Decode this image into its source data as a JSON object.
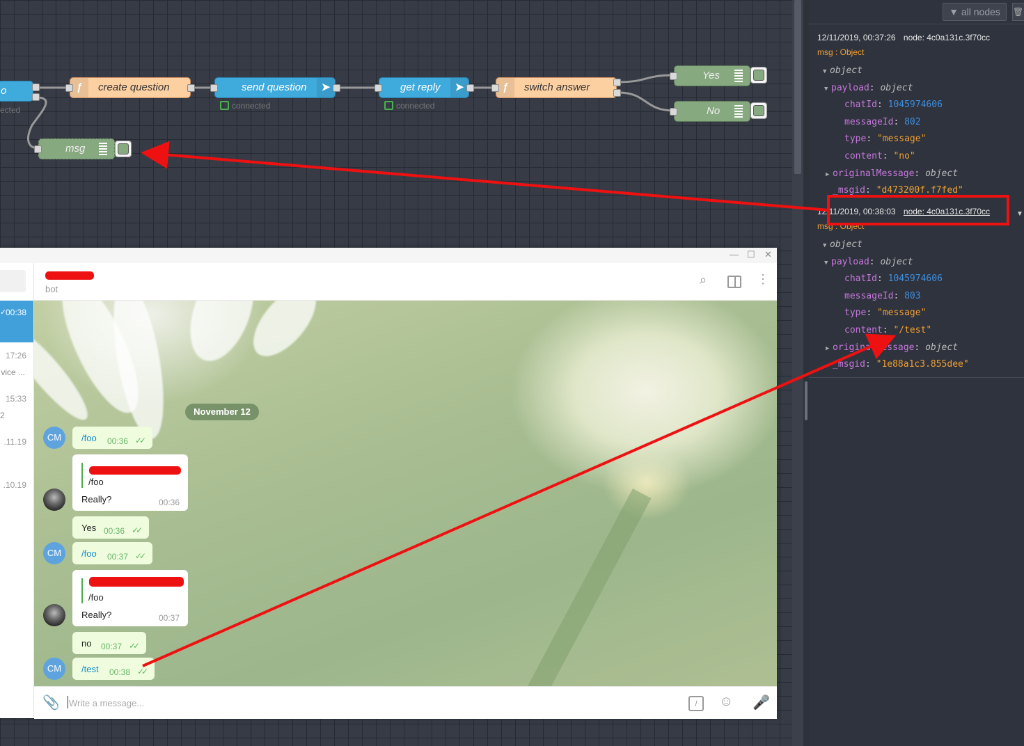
{
  "flow": {
    "nodes": {
      "left_partial": "o",
      "left_partial_status": "ected",
      "create_question": "create question",
      "send_question": "send question",
      "get_reply": "get reply",
      "switch_answer": "switch answer",
      "yes": "Yes",
      "no": "No",
      "msg": "msg"
    },
    "status_connected": "connected"
  },
  "debug": {
    "filter_label": "all nodes",
    "messages": [
      {
        "timestamp": "12/11/2019, 00:37:26",
        "node": "node: 4c0a131c.3f70cc",
        "type": "msg : Object",
        "root": "object",
        "payload_key": "payload",
        "payload_type": "object",
        "fields": [
          {
            "key": "chatId",
            "value": "1045974606"
          },
          {
            "key": "messageId",
            "value": "802"
          },
          {
            "key": "type",
            "value": "\"message\""
          },
          {
            "key": "content",
            "value": "\"no\""
          }
        ],
        "original_key": "originalMessage",
        "original_type": "object",
        "msgid_key": "_msgid",
        "msgid": "\"d473200f.f7fed\""
      },
      {
        "timestamp": "12/11/2019, 00:38:03",
        "node": "node: 4c0a131c.3f70cc",
        "type": "msg : Object",
        "root": "object",
        "payload_key": "payload",
        "payload_type": "object",
        "fields": [
          {
            "key": "chatId",
            "value": "1045974606"
          },
          {
            "key": "messageId",
            "value": "803"
          },
          {
            "key": "type",
            "value": "\"message\""
          },
          {
            "key": "content",
            "value": "\"/test\""
          }
        ],
        "original_key": "originalMessage",
        "original_type": "object",
        "msgid_key": "_msgid",
        "msgid": "\"1e88a1c3.855dee\""
      }
    ]
  },
  "telegram": {
    "chat_subtitle": "bot",
    "left_list": {
      "selected_time": "00:38",
      "times": [
        "17:26",
        "15:33",
        ".11.19",
        ".10.19"
      ],
      "snippets": [
        "vice ...",
        "2"
      ]
    },
    "date_separator": "November 12",
    "avatar_initials": "CM",
    "messages": {
      "m1_text": "/foo",
      "m1_time": "00:36",
      "m2_quote": "/foo",
      "m2_text": "Really?",
      "m2_time": "00:36",
      "m3_text": "Yes",
      "m3_time": "00:36",
      "m4_text": "/foo",
      "m4_time": "00:37",
      "m5_quote": "/foo",
      "m5_text": "Really?",
      "m5_time": "00:37",
      "m6_text": "no",
      "m6_time": "00:37",
      "m7_text": "/test",
      "m7_time": "00:38"
    },
    "input_placeholder": "Write a message...",
    "colors": {
      "accent": "#419fd9",
      "outgoing": "#effdde",
      "annotation": "#ee1111"
    }
  }
}
